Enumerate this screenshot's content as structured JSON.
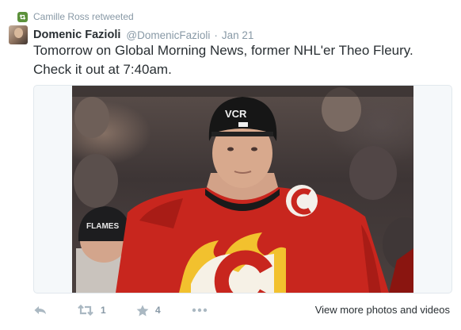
{
  "context": {
    "retweeted_by": "Camille Ross retweeted"
  },
  "tweet": {
    "author_name": "Domenic Fazioli",
    "author_handle": "@DomenicFazioli",
    "separator": "·",
    "date": "Jan 21",
    "text": "Tomorrow on Global Morning News, former NHL'er Theo Fleury. Check it out at 7:40am."
  },
  "actions": {
    "reply_icon": "reply-icon",
    "retweet_icon": "retweet-icon",
    "retweet_count": "1",
    "favorite_icon": "star-icon",
    "favorite_count": "4",
    "more_icon": "more-icon",
    "view_more": "View more photos and videos"
  },
  "media": {
    "helmet_text": "VCR",
    "back_helmet_text": "FLAMES"
  },
  "colors": {
    "retweet_green": "#5c913b",
    "meta_gray": "#8899a6",
    "icon_gray": "#aab8c2",
    "jersey_red": "#c8261e",
    "flame_yellow": "#f2c12e"
  }
}
